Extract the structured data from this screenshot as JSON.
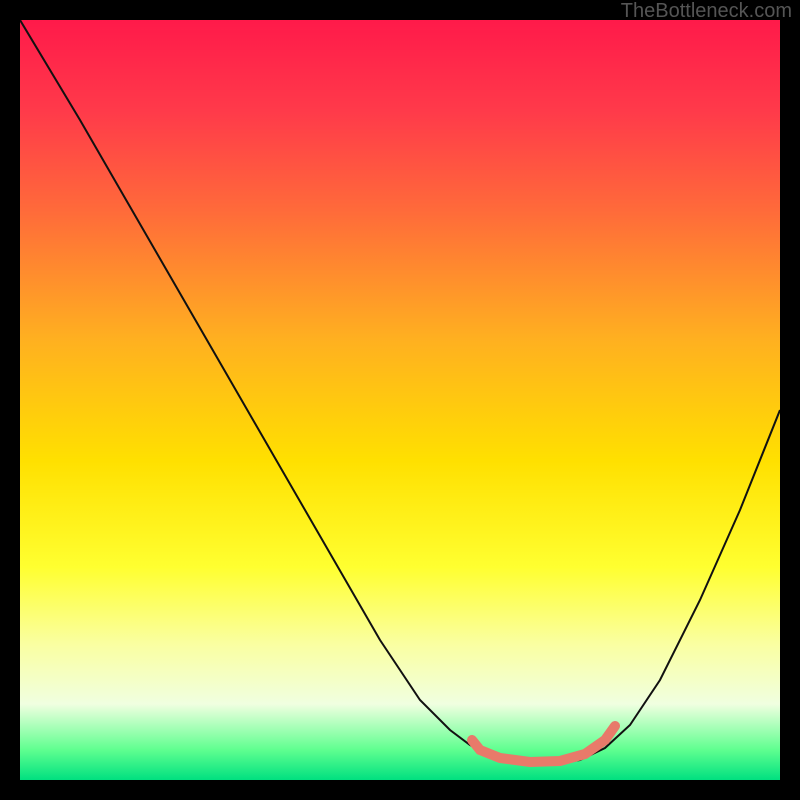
{
  "watermark": "TheBottleneck.com",
  "chart_data": {
    "type": "line",
    "title": "",
    "xlabel": "",
    "ylabel": "",
    "x": [
      0,
      5,
      10,
      15,
      20,
      25,
      30,
      35,
      40,
      45,
      50,
      55,
      58,
      60,
      63,
      66,
      70,
      74,
      78,
      82,
      86,
      90,
      94,
      100
    ],
    "values": [
      100,
      92,
      84,
      76,
      68,
      60,
      52,
      44,
      36,
      28,
      20,
      13,
      8,
      5,
      3,
      2,
      1,
      1,
      2,
      4,
      8,
      14,
      22,
      40
    ],
    "xlim": [
      0,
      100
    ],
    "ylim": [
      0,
      100
    ],
    "highlight": {
      "x_start": 58,
      "x_end": 80,
      "y": 2
    }
  }
}
